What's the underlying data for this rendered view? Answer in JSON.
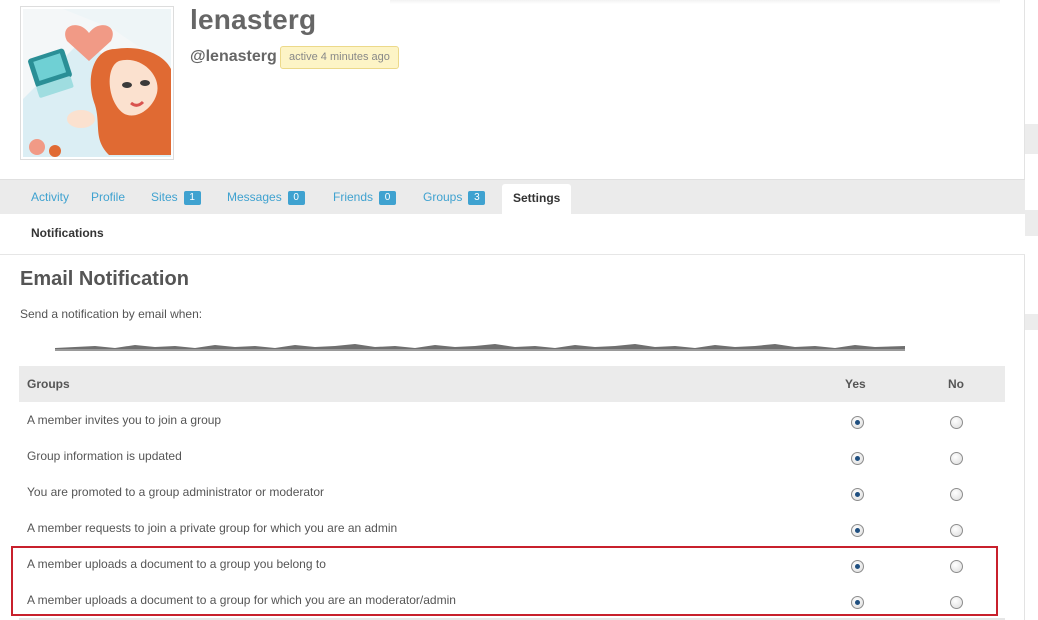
{
  "profile": {
    "display_name": "lenasterg",
    "handle": "@lenasterg",
    "last_active": "active 4 minutes ago"
  },
  "tabs": [
    {
      "label": "Activity",
      "count": ""
    },
    {
      "label": "Profile",
      "count": ""
    },
    {
      "label": "Sites",
      "count": "1"
    },
    {
      "label": "Messages",
      "count": "0"
    },
    {
      "label": "Friends",
      "count": "0"
    },
    {
      "label": "Groups",
      "count": "3"
    },
    {
      "label": "Settings",
      "count": "",
      "active": true
    }
  ],
  "subnav": {
    "active_item": "Notifications"
  },
  "section": {
    "title": "Email Notification",
    "description": "Send a notification by email when:"
  },
  "table": {
    "headers": {
      "category": "Groups",
      "yes": "Yes",
      "no": "No"
    },
    "rows": [
      {
        "label": "A member invites you to join a group",
        "value": "yes"
      },
      {
        "label": "Group information is updated",
        "value": "yes"
      },
      {
        "label": "You are promoted to a group administrator or moderator",
        "value": "yes"
      },
      {
        "label": "A member requests to join a private group for which you are an admin",
        "value": "yes"
      },
      {
        "label": "A member uploads a document to a group you belong to",
        "value": "yes"
      },
      {
        "label": "A member uploads a document to a group for which you are an moderator/admin",
        "value": "yes"
      }
    ]
  },
  "colors": {
    "link": "#3fa2d0",
    "highlight_border": "#c8202c",
    "badge_bg": "#fdf4c6"
  }
}
